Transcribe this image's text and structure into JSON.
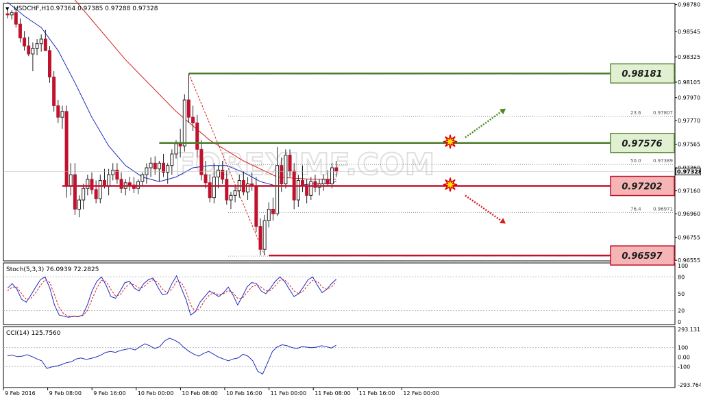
{
  "header": {
    "symbol_label": "USDCHF,H1",
    "ohlc_label": "0.97364 0.97385 0.97288 0.97328"
  },
  "colors": {
    "frame": "#000000",
    "grid": "#c8c8c8",
    "bull_candle": "#2e8b8b",
    "bear_candle": "#c0122c",
    "ma_blue": "#1c2cc0",
    "ma_red": "#d62020",
    "support_line": "#c0122c",
    "resistance_line": "#4a7a2a",
    "badge_green_fill": "#e2f0d2",
    "badge_green_border": "#5b8a3a",
    "badge_red_fill": "#f5b5b5",
    "badge_red_border": "#c0122c",
    "stoch_main": "#1c2cc0",
    "stoch_signal": "#d62020",
    "cci_line": "#1c2cc0",
    "watermark": "#dcdcdc"
  },
  "watermark_text": "FOREXIMF.COM",
  "chart_data": [
    {
      "type": "candlestick",
      "title": "USDCHF,H1",
      "ylim": [
        0.9655,
        0.9879
      ],
      "y_ticks": [
        "0.98780",
        "0.98545",
        "0.98325",
        "0.98105",
        "0.97970",
        "0.97770",
        "0.97565",
        "0.97360",
        "0.97160",
        "0.96960",
        "0.96755",
        "0.96555"
      ],
      "current_price_label": "0.97328",
      "x_tick_labels": [
        "9 Feb 2016",
        "9 Feb 08:00",
        "9 Feb 16:00",
        "10 Feb 00:00",
        "10 Feb 08:00",
        "10 Feb 16:00",
        "11 Feb 00:00",
        "11 Feb 08:00",
        "11 Feb 16:00",
        "12 Feb 00:00"
      ],
      "candles_ohlc": [
        [
          0.987,
          0.9874,
          0.9866,
          0.9869
        ],
        [
          0.9869,
          0.9873,
          0.9865,
          0.9871
        ],
        [
          0.9871,
          0.9876,
          0.9858,
          0.9861
        ],
        [
          0.9861,
          0.9866,
          0.9845,
          0.9849
        ],
        [
          0.9849,
          0.9855,
          0.9838,
          0.9842
        ],
        [
          0.9842,
          0.985,
          0.9833,
          0.9835
        ],
        [
          0.9835,
          0.9845,
          0.982,
          0.984
        ],
        [
          0.984,
          0.9848,
          0.9834,
          0.9844
        ],
        [
          0.9844,
          0.9852,
          0.9837,
          0.9848
        ],
        [
          0.9848,
          0.9856,
          0.984,
          0.9838
        ],
        [
          0.9838,
          0.9842,
          0.981,
          0.9815
        ],
        [
          0.9815,
          0.982,
          0.9785,
          0.979
        ],
        [
          0.979,
          0.9795,
          0.9775,
          0.978
        ],
        [
          0.978,
          0.979,
          0.977,
          0.9785
        ],
        [
          0.9785,
          0.979,
          0.971,
          0.972
        ],
        [
          0.972,
          0.974,
          0.9712,
          0.973
        ],
        [
          0.973,
          0.974,
          0.9695,
          0.97
        ],
        [
          0.97,
          0.9712,
          0.9693,
          0.9708
        ],
        [
          0.9708,
          0.9722,
          0.97,
          0.9718
        ],
        [
          0.9718,
          0.973,
          0.9712,
          0.9726
        ],
        [
          0.9726,
          0.9732,
          0.9713,
          0.9717
        ],
        [
          0.9717,
          0.9725,
          0.9705,
          0.9709
        ],
        [
          0.9709,
          0.973,
          0.9705,
          0.9725
        ],
        [
          0.9725,
          0.9735,
          0.9718,
          0.972
        ],
        [
          0.972,
          0.9735,
          0.9712,
          0.973
        ],
        [
          0.973,
          0.974,
          0.9725,
          0.9734
        ],
        [
          0.9734,
          0.974,
          0.9722,
          0.9726
        ],
        [
          0.9726,
          0.9732,
          0.9714,
          0.9718
        ],
        [
          0.9718,
          0.9726,
          0.9712,
          0.9723
        ],
        [
          0.9723,
          0.9728,
          0.9716,
          0.9721
        ],
        [
          0.9721,
          0.9728,
          0.9714,
          0.9718
        ],
        [
          0.9718,
          0.9726,
          0.9713,
          0.9724
        ],
        [
          0.9724,
          0.9732,
          0.972,
          0.973
        ],
        [
          0.973,
          0.974,
          0.9722,
          0.9736
        ],
        [
          0.9736,
          0.9745,
          0.9728,
          0.974
        ],
        [
          0.974,
          0.9746,
          0.973,
          0.9735
        ],
        [
          0.9735,
          0.9742,
          0.9724,
          0.974
        ],
        [
          0.974,
          0.9748,
          0.9728,
          0.9732
        ],
        [
          0.9732,
          0.974,
          0.9722,
          0.9738
        ],
        [
          0.9738,
          0.9752,
          0.973,
          0.9748
        ],
        [
          0.9748,
          0.976,
          0.9744,
          0.9757
        ],
        [
          0.9757,
          0.977,
          0.9745,
          0.9755
        ],
        [
          0.9755,
          0.98,
          0.975,
          0.9795
        ],
        [
          0.9795,
          0.9818,
          0.9775,
          0.978
        ],
        [
          0.978,
          0.979,
          0.9768,
          0.9775
        ],
        [
          0.9775,
          0.9782,
          0.9745,
          0.9752
        ],
        [
          0.9752,
          0.976,
          0.9725,
          0.973
        ],
        [
          0.973,
          0.9742,
          0.9718,
          0.9723
        ],
        [
          0.9723,
          0.973,
          0.9706,
          0.971
        ],
        [
          0.971,
          0.974,
          0.9705,
          0.9728
        ],
        [
          0.9728,
          0.9738,
          0.9718,
          0.9734
        ],
        [
          0.9734,
          0.9742,
          0.9722,
          0.9726
        ],
        [
          0.9726,
          0.9734,
          0.9704,
          0.9708
        ],
        [
          0.9708,
          0.9715,
          0.97,
          0.9712
        ],
        [
          0.9712,
          0.972,
          0.9706,
          0.9716
        ],
        [
          0.9716,
          0.973,
          0.971,
          0.9725
        ],
        [
          0.9725,
          0.9733,
          0.9712,
          0.9715
        ],
        [
          0.9715,
          0.9728,
          0.9708,
          0.9722
        ],
        [
          0.9722,
          0.9732,
          0.9716,
          0.972
        ],
        [
          0.972,
          0.9728,
          0.968,
          0.9685
        ],
        [
          0.9685,
          0.9692,
          0.966,
          0.9665
        ],
        [
          0.9665,
          0.9695,
          0.966,
          0.969
        ],
        [
          0.969,
          0.9706,
          0.9684,
          0.97
        ],
        [
          0.97,
          0.971,
          0.969,
          0.9696
        ],
        [
          0.9696,
          0.9754,
          0.9694,
          0.9738
        ],
        [
          0.9738,
          0.9745,
          0.9715,
          0.9722
        ],
        [
          0.9722,
          0.9752,
          0.9718,
          0.9747
        ],
        [
          0.9747,
          0.9752,
          0.9728,
          0.9733
        ],
        [
          0.9733,
          0.974,
          0.97,
          0.9708
        ],
        [
          0.9708,
          0.973,
          0.9702,
          0.9725
        ],
        [
          0.9725,
          0.9738,
          0.9715,
          0.972
        ],
        [
          0.972,
          0.9726,
          0.9705,
          0.9712
        ],
        [
          0.9712,
          0.9728,
          0.9708,
          0.9724
        ],
        [
          0.9724,
          0.973,
          0.9715,
          0.9719
        ],
        [
          0.9719,
          0.9726,
          0.9712,
          0.9722
        ],
        [
          0.9722,
          0.973,
          0.9716,
          0.9726
        ],
        [
          0.9726,
          0.9734,
          0.972,
          0.9722
        ],
        [
          0.9722,
          0.974,
          0.9718,
          0.9736
        ],
        [
          0.9736,
          0.9742,
          0.9728,
          0.9733
        ]
      ],
      "ma_blue": [
        [
          0,
          0.988
        ],
        [
          4,
          0.9868
        ],
        [
          8,
          0.9858
        ],
        [
          12,
          0.9838
        ],
        [
          16,
          0.981
        ],
        [
          20,
          0.978
        ],
        [
          24,
          0.9755
        ],
        [
          28,
          0.9738
        ],
        [
          32,
          0.9728
        ],
        [
          36,
          0.9724
        ],
        [
          40,
          0.9728
        ],
        [
          44,
          0.9736
        ],
        [
          48,
          0.9738
        ],
        [
          52,
          0.9738
        ],
        [
          56,
          0.9732
        ],
        [
          60,
          0.9724
        ],
        [
          64,
          0.972
        ],
        [
          68,
          0.972
        ],
        [
          72,
          0.9722
        ],
        [
          76,
          0.9722
        ],
        [
          78,
          0.9724
        ]
      ],
      "ma_red": [
        [
          16,
          0.9882
        ],
        [
          28,
          0.983
        ],
        [
          40,
          0.9785
        ],
        [
          48,
          0.976
        ],
        [
          56,
          0.9742
        ],
        [
          64,
          0.9728
        ],
        [
          72,
          0.9726
        ],
        [
          78,
          0.9726
        ]
      ],
      "fibonacci_levels": [
        {
          "label": "23.6",
          "price_label": "0.97807",
          "value": 0.97807
        },
        {
          "label": "50.0",
          "price_label": "0.97389",
          "value": 0.97389
        },
        {
          "label": "76.4",
          "price_label": "0.96971",
          "value": 0.96971
        }
      ],
      "horizontal_levels": [
        {
          "label": "0.98181",
          "value": 0.98181,
          "kind": "resistance",
          "from_index": 43
        },
        {
          "label": "0.97576",
          "value": 0.97576,
          "kind": "resistance",
          "from_index": 36
        },
        {
          "label": "0.97202",
          "value": 0.97202,
          "kind": "support",
          "from_index": 13
        },
        {
          "label": "0.96597",
          "value": 0.96597,
          "kind": "support",
          "from_index": 62
        }
      ],
      "fib_diagonal": {
        "from": [
          43,
          0.9818
        ],
        "to": [
          61,
          0.966
        ]
      },
      "projections": [
        {
          "direction": "up",
          "at_value": 0.97576
        },
        {
          "direction": "down",
          "at_value": 0.97202
        }
      ]
    },
    {
      "type": "line",
      "title": "Stoch(5,3,3) 76.0939 72.2825",
      "ylim": [
        0,
        100
      ],
      "y_ticks": [
        "100",
        "80",
        "50",
        "20",
        "0"
      ],
      "series": [
        {
          "name": "Stoch main",
          "values": [
            60,
            68,
            58,
            40,
            35,
            48,
            62,
            75,
            80,
            60,
            30,
            12,
            10,
            8,
            10,
            9,
            12,
            30,
            55,
            72,
            80,
            65,
            45,
            42,
            55,
            70,
            72,
            60,
            55,
            68,
            75,
            78,
            62,
            48,
            50,
            68,
            82,
            60,
            40,
            12,
            18,
            35,
            45,
            55,
            50,
            45,
            52,
            62,
            48,
            30,
            45,
            62,
            70,
            68,
            55,
            50,
            60,
            72,
            80,
            72,
            58,
            45,
            50,
            62,
            75,
            80,
            65,
            52,
            58,
            68,
            76
          ]
        },
        {
          "name": "Stoch signal",
          "values": [
            55,
            62,
            62,
            50,
            40,
            42,
            52,
            65,
            75,
            70,
            48,
            25,
            14,
            10,
            9,
            10,
            11,
            20,
            40,
            60,
            74,
            72,
            58,
            46,
            48,
            60,
            68,
            66,
            60,
            62,
            70,
            75,
            70,
            58,
            52,
            58,
            72,
            70,
            55,
            30,
            18,
            25,
            38,
            48,
            52,
            48,
            50,
            56,
            52,
            42,
            42,
            52,
            62,
            66,
            62,
            55,
            56,
            64,
            74,
            75,
            66,
            55,
            50,
            55,
            66,
            74,
            72,
            62,
            58,
            62,
            72
          ]
        }
      ]
    },
    {
      "type": "line",
      "title": "CCI(14) 125.7560",
      "ylim": [
        -293.764,
        293.131
      ],
      "y_ticks": [
        "293.131",
        "100",
        "0.00",
        "-100",
        "-293.764"
      ],
      "series": [
        {
          "name": "CCI",
          "values": [
            15,
            20,
            5,
            10,
            25,
            5,
            -20,
            -40,
            -120,
            -105,
            -95,
            -80,
            -60,
            -50,
            -20,
            -10,
            -25,
            -15,
            0,
            20,
            50,
            60,
            50,
            70,
            80,
            90,
            75,
            110,
            140,
            120,
            90,
            110,
            170,
            200,
            180,
            150,
            100,
            60,
            30,
            10,
            40,
            60,
            30,
            0,
            -20,
            -40,
            -20,
            -10,
            30,
            10,
            -40,
            -150,
            -180,
            -60,
            60,
            110,
            130,
            120,
            100,
            90,
            110,
            105,
            100,
            105,
            120,
            110,
            95,
            126
          ]
        }
      ]
    }
  ]
}
